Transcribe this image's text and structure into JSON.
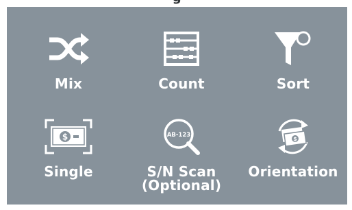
{
  "header": {
    "title_fragment": "g"
  },
  "modes": [
    {
      "key": "mix",
      "label": "Mix",
      "icon": "shuffle-icon"
    },
    {
      "key": "count",
      "label": "Count",
      "icon": "abacus-icon"
    },
    {
      "key": "sort",
      "label": "Sort",
      "icon": "filter-funnel-icon"
    },
    {
      "key": "single",
      "label": "Single",
      "icon": "banknote-scan-icon"
    },
    {
      "key": "sn_scan",
      "label": "S/N Scan",
      "sublabel": "(Optional)",
      "icon": "serial-magnifier-icon",
      "magnifier_text": "AB-123"
    },
    {
      "key": "orientation",
      "label": "Orientation",
      "icon": "banknote-rotate-icon"
    }
  ],
  "colors": {
    "panel_bg": "#87929b",
    "icon_fg": "#ffffff",
    "label_fg": "#ffffff"
  }
}
